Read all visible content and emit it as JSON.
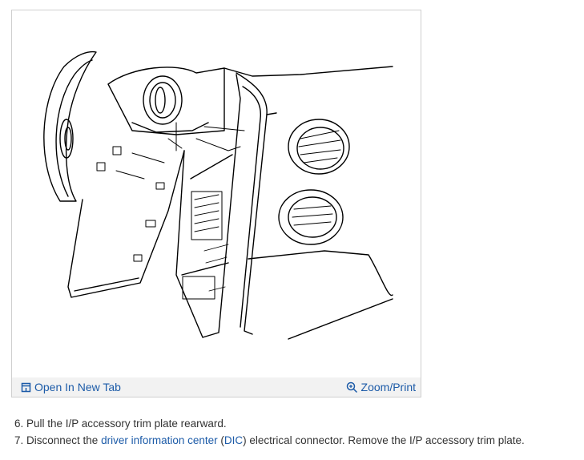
{
  "figure": {
    "open_tab_label": "Open In New Tab",
    "zoom_label": "Zoom/Print",
    "icons": {
      "open_tab": "open-in-new-tab-icon",
      "zoom": "magnifier-plus-icon"
    }
  },
  "steps": [
    {
      "text": "6. Pull the I/P accessory trim plate rearward."
    },
    {
      "before": "7. Disconnect the ",
      "link1": "driver information center",
      "middle1": " (",
      "link2": "DIC",
      "after": ") electrical connector. Remove the I/P accessory trim plate."
    }
  ],
  "colors": {
    "link": "#1c5ba8",
    "text": "#333333",
    "toolbar_bg": "#f2f2f2",
    "border": "#cfcfcf"
  }
}
